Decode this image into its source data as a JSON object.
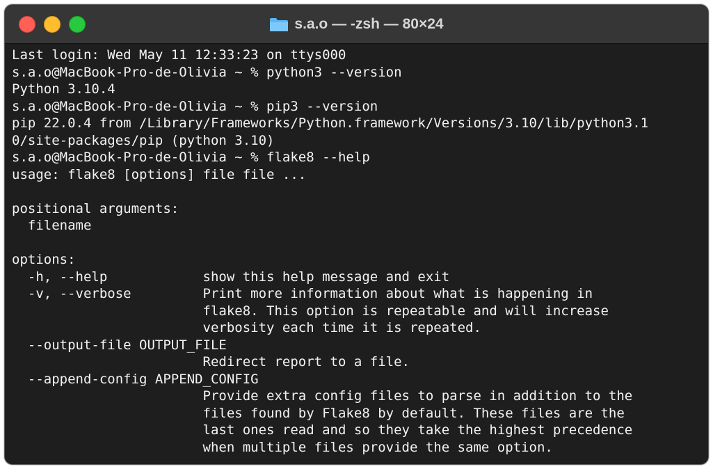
{
  "window": {
    "title": "s.a.o — -zsh — 80×24",
    "folder_icon": "folder-icon"
  },
  "colors": {
    "background": "#1e1e1e",
    "text": "#f2f2f2",
    "titlebar": "#363636",
    "close": "#fe5f57",
    "minimize": "#febc2e",
    "zoom": "#28c840",
    "folder": "#5ab7f5"
  },
  "terminal": {
    "lines": [
      "Last login: Wed May 11 12:33:23 on ttys000",
      "s.a.o@MacBook-Pro-de-Olivia ~ % python3 --version",
      "Python 3.10.4",
      "s.a.o@MacBook-Pro-de-Olivia ~ % pip3 --version",
      "pip 22.0.4 from /Library/Frameworks/Python.framework/Versions/3.10/lib/python3.1",
      "0/site-packages/pip (python 3.10)",
      "s.a.o@MacBook-Pro-de-Olivia ~ % flake8 --help",
      "usage: flake8 [options] file file ...",
      "",
      "positional arguments:",
      "  filename",
      "",
      "options:",
      "  -h, --help            show this help message and exit",
      "  -v, --verbose         Print more information about what is happening in",
      "                        flake8. This option is repeatable and will increase",
      "                        verbosity each time it is repeated.",
      "  --output-file OUTPUT_FILE",
      "                        Redirect report to a file.",
      "  --append-config APPEND_CONFIG",
      "                        Provide extra config files to parse in addition to the",
      "                        files found by Flake8 by default. These files are the",
      "                        last ones read and so they take the highest precedence",
      "                        when multiple files provide the same option."
    ]
  }
}
